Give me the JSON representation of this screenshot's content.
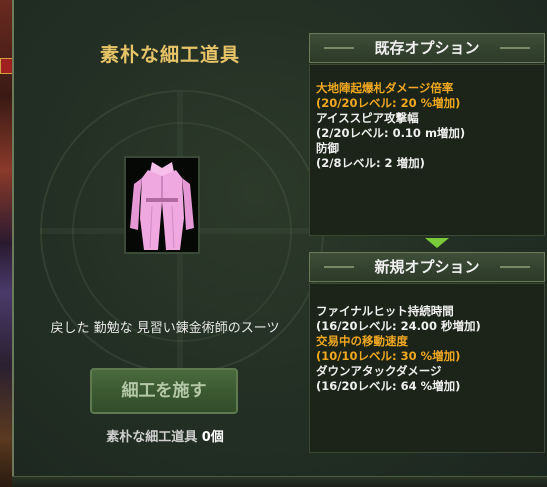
{
  "window": {
    "title": "素朴な細工道具",
    "item_name": "戻した 勤勉な 見習い錬金術師のスーツ",
    "craft_button_label": "細工を施す",
    "tool_label": "素朴な細工道具",
    "tool_count": "0個"
  },
  "existing_options": {
    "header": "既存オプション",
    "options": [
      {
        "name": "大地陣起爆札ダメージ倍率",
        "value": "(20/20レベル: 20 %増加)",
        "highlight": true
      },
      {
        "name": "アイススピア攻撃幅",
        "value": "(2/20レベル: 0.10 m増加)",
        "highlight": false
      },
      {
        "name": "防御",
        "value": "(2/8レベル: 2 増加)",
        "highlight": false
      }
    ]
  },
  "new_options": {
    "header": "新規オプション",
    "options": [
      {
        "name": "ファイナルヒット持続時間",
        "value": "(16/20レベル: 24.00 秒増加)",
        "highlight": false
      },
      {
        "name": "交易中の移動速度",
        "value": "(10/10レベル: 30 %増加)",
        "highlight": true
      },
      {
        "name": "ダウンアタックダメージ",
        "value": "(16/20レベル: 64 %増加)",
        "highlight": false
      }
    ]
  },
  "colors": {
    "title": "#e8c468",
    "highlight": "#f0a820",
    "arrow": "#7acb3a",
    "coat": "#f0a8e0"
  },
  "icons": {
    "item": "pink-coat-icon",
    "arrow": "arrow-down-icon"
  }
}
